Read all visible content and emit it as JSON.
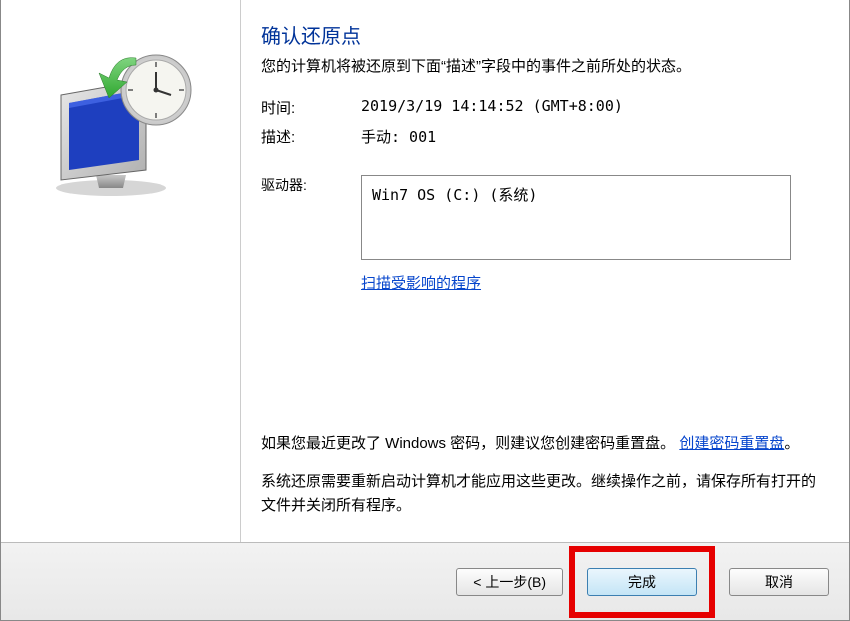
{
  "title": "确认还原点",
  "subtitle": "您的计算机将被还原到下面“描述”字段中的事件之前所处的状态。",
  "fields": {
    "time_label": "时间:",
    "time_value": "2019/3/19 14:14:52 (GMT+8:00)",
    "desc_label": "描述:",
    "desc_value": "手动: 001",
    "drive_label": "驱动器:",
    "drive_value": "Win7 OS (C:) (系统)"
  },
  "scan_link": "扫描受影响的程序",
  "password_note_prefix": "如果您最近更改了 Windows 密码，则建议您创建密码重置盘。",
  "password_link": "创建密码重置盘",
  "password_note_suffix": "。",
  "restart_note": "系统还原需要重新启动计算机才能应用这些更改。继续操作之前，请保存所有打开的文件并关闭所有程序。",
  "buttons": {
    "back": "< 上一步(B)",
    "finish": "完成",
    "cancel": "取消"
  }
}
